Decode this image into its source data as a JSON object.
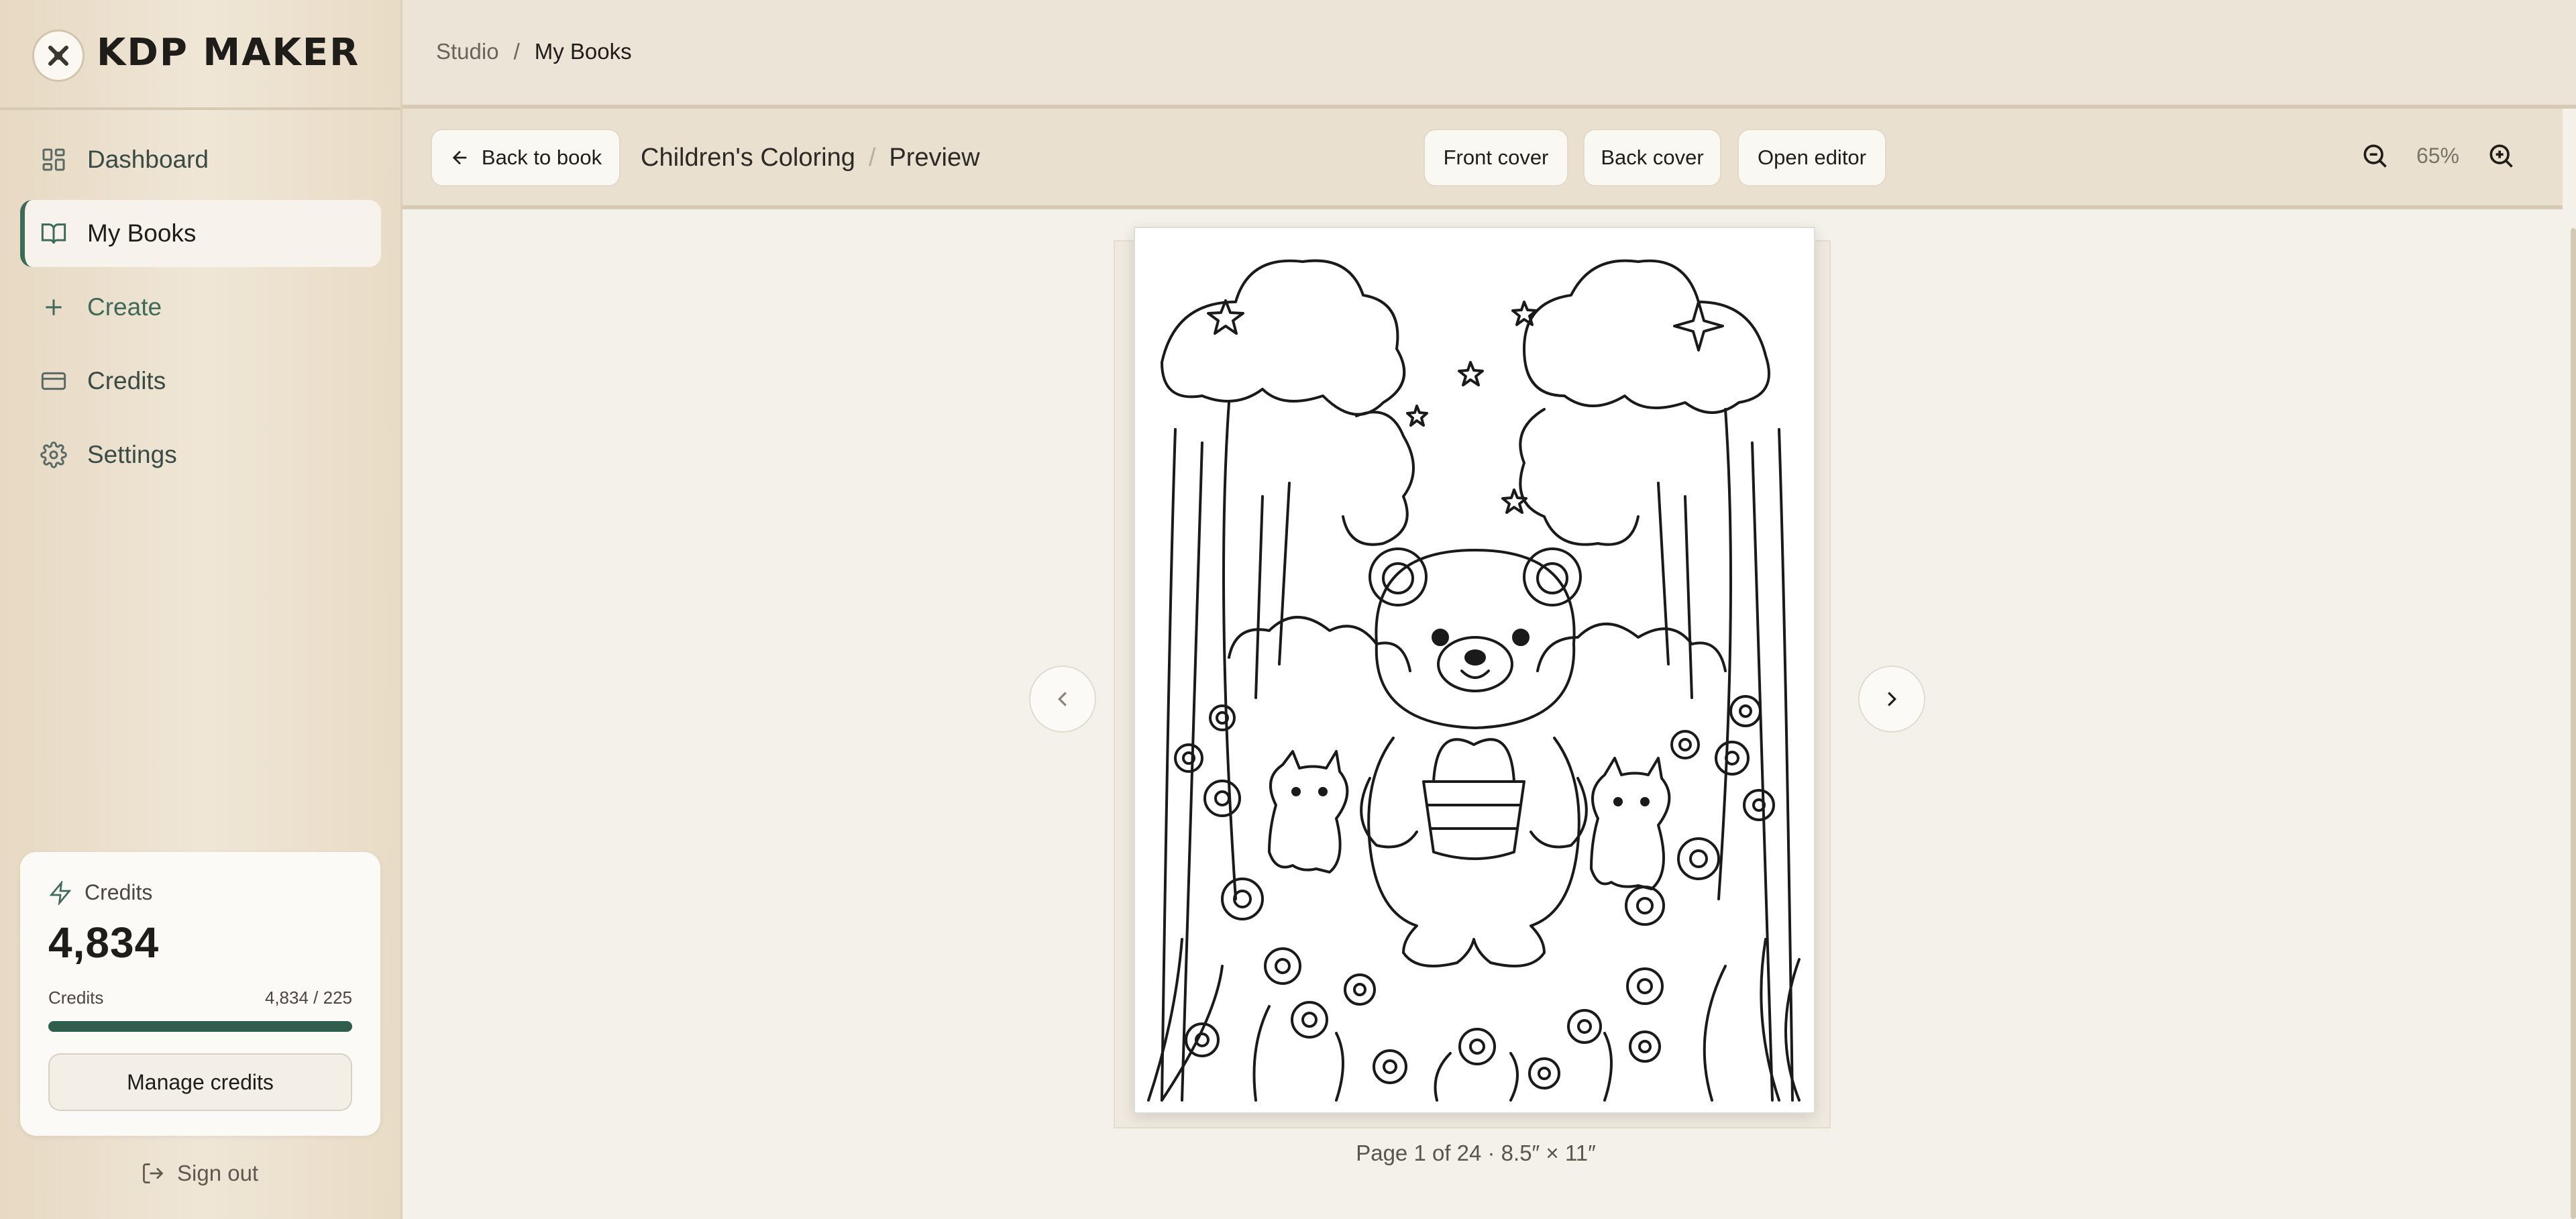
{
  "app": {
    "logo_text": "KDP MAKER"
  },
  "breadcrumb": {
    "root": "Studio",
    "separator": "/",
    "current": "My Books"
  },
  "sidebar": {
    "items": [
      {
        "label": "Dashboard",
        "icon": "dashboard-icon"
      },
      {
        "label": "My Books",
        "icon": "book-open-icon",
        "active": true
      },
      {
        "label": "Create",
        "icon": "plus-icon"
      },
      {
        "label": "Credits",
        "icon": "credit-card-icon"
      },
      {
        "label": "Settings",
        "icon": "gear-icon"
      }
    ],
    "credits_card": {
      "heading": "Credits",
      "balance": "4,834",
      "row_label": "Credits",
      "row_value": "4,834 / 225",
      "progress": 1.0,
      "button": "Manage credits"
    },
    "sign_out": "Sign out"
  },
  "toolbar": {
    "back_label": "Back to book",
    "book_title": "Children's Coloring",
    "title_separator": "/",
    "view_label": "Preview",
    "front_cover": "Front cover",
    "back_cover": "Back cover",
    "open_editor": "Open editor",
    "zoom": "65%"
  },
  "preview": {
    "page_info": "Page 1 of 24 · 8.5″ × 11″",
    "illustration": "coloring-page-bear-with-basket"
  },
  "colors": {
    "accent": "#2f5e4e",
    "sidebar_bg": "#ece2d0",
    "main_bg": "#f4f1ea"
  }
}
